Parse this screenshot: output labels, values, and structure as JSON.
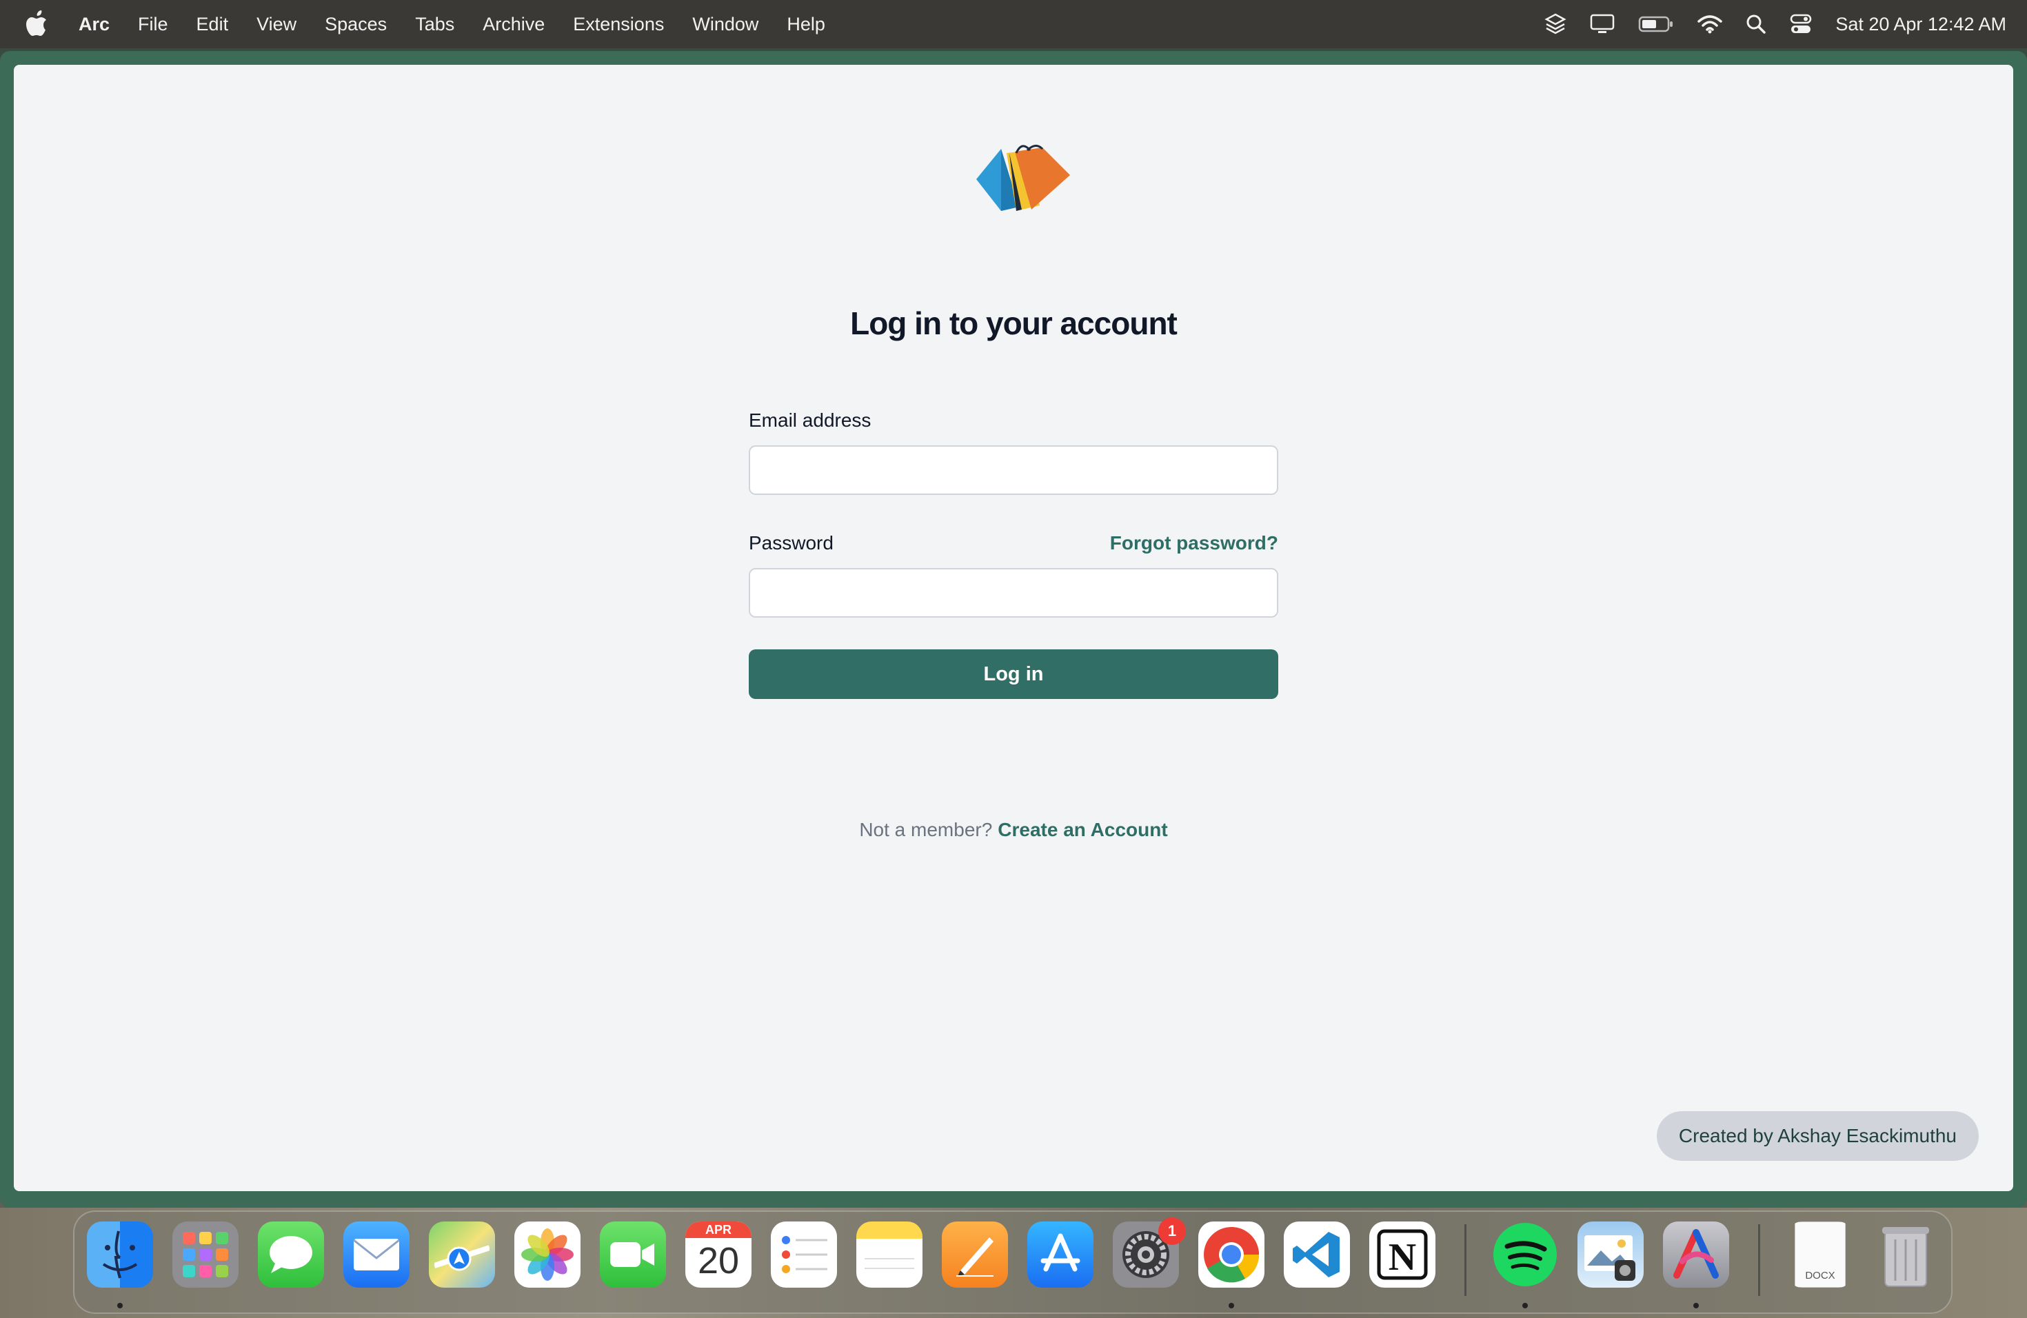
{
  "menubar": {
    "app_name": "Arc",
    "items": [
      "File",
      "Edit",
      "View",
      "Spaces",
      "Tabs",
      "Archive",
      "Extensions",
      "Window",
      "Help"
    ],
    "status_icons": [
      "layers-icon",
      "display-icon",
      "battery-icon",
      "wifi-icon",
      "search-icon",
      "control-center-icon"
    ],
    "clock": "Sat 20 Apr  12:42 AM"
  },
  "login": {
    "title": "Log in to your account",
    "email_label": "Email address",
    "email_value": "",
    "password_label": "Password",
    "password_value": "",
    "forgot_link": "Forgot password?",
    "submit_label": "Log in",
    "signup_prompt": "Not a member?",
    "signup_link": "Create an Account"
  },
  "credit": "Created by Akshay Esackimuthu",
  "dock": {
    "apps": [
      "Finder",
      "Launchpad",
      "Messages",
      "Mail",
      "Maps",
      "Photos",
      "FaceTime",
      "Calendar",
      "Reminders",
      "Notes",
      "Pages",
      "App Store",
      "System Settings",
      "Google Chrome",
      "Visual Studio Code",
      "Notion",
      "Spotify",
      "Preview",
      "Affinity",
      "Document",
      "Trash"
    ],
    "calendar_month": "APR",
    "calendar_day": "20",
    "settings_badge": "1",
    "document_label": "DOCX"
  },
  "colors": {
    "primary": "#316e66",
    "link": "#2f6e65",
    "window_border": "#3c6b58",
    "page_bg": "#f3f4f6"
  }
}
